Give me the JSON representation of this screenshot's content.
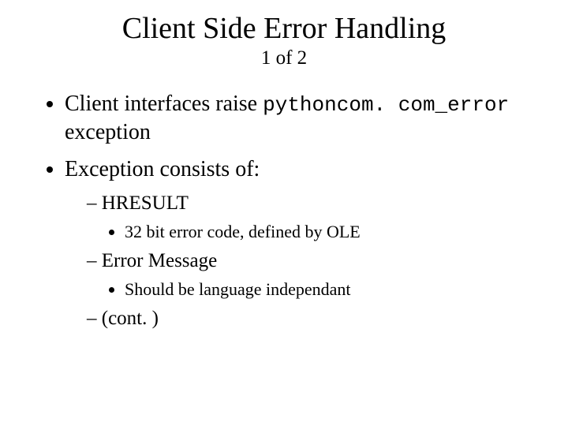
{
  "title": "Client Side Error Handling",
  "subtitle": "1 of 2",
  "bullet1_prefix": "Client interfaces raise ",
  "bullet1_code": "pythoncom. com_error",
  "bullet1_suffix": " exception",
  "bullet2": "Exception consists of:",
  "sub1": "HRESULT",
  "sub1_detail": "32 bit error code, defined by OLE",
  "sub2": "Error Message",
  "sub2_detail": "Should be language independant",
  "sub3": "(cont. )"
}
